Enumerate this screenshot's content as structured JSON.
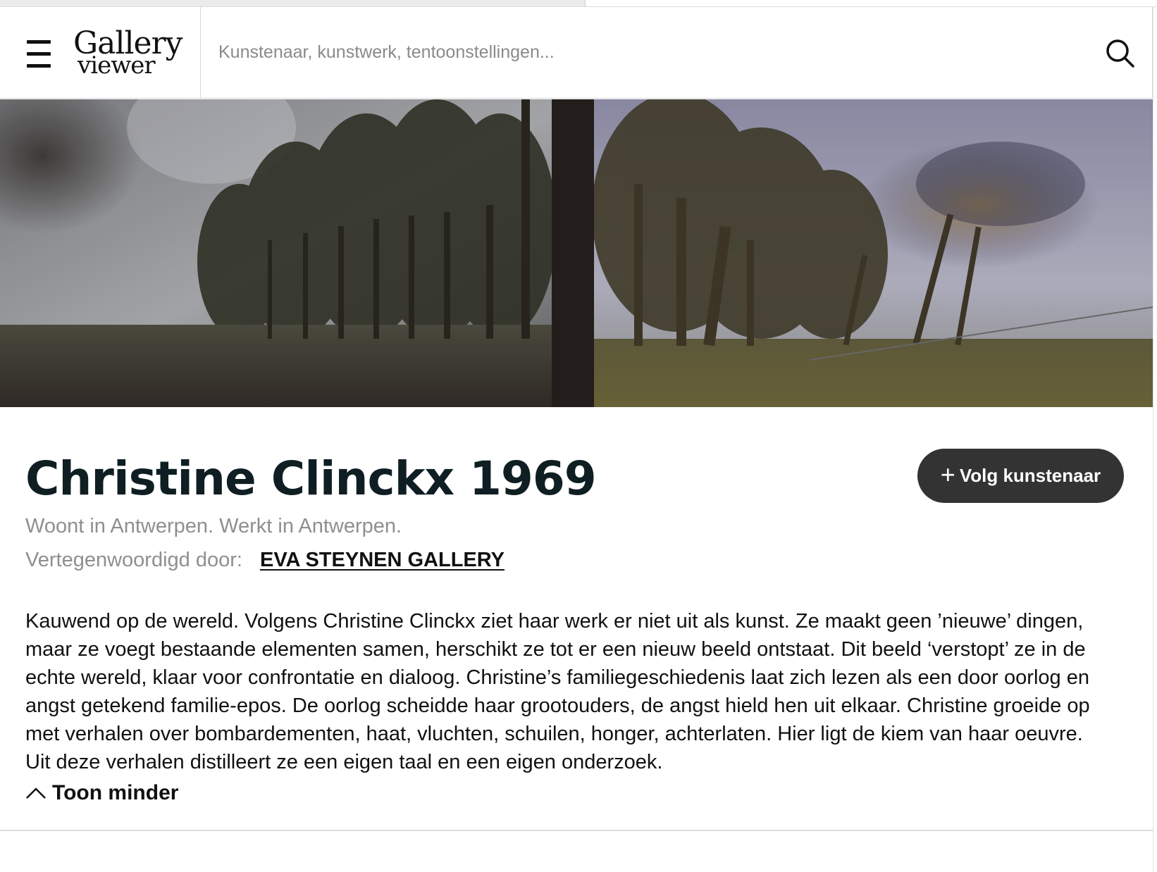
{
  "header": {
    "logo_line1": "Gallery",
    "logo_line2": "viewer",
    "search_placeholder": "Kunstenaar, kunstwerk, tentoonstellingen..."
  },
  "artist": {
    "name": "Christine Clinckx 1969",
    "follow_plus": "+",
    "follow_label": "Volg kunstenaar",
    "location": "Woont in Antwerpen. Werkt in Antwerpen.",
    "represented_label": "Vertegenwoordigd door:",
    "gallery_name": "EVA STEYNEN GALLERY",
    "bio_lines": [
      "Kauwend op de wereld. Volgens Christine Clinckx ziet haar werk er niet uit als kunst. Ze maakt geen ’nieuwe’ dingen,",
      "maar ze voegt bestaande elementen samen, herschikt ze tot er een nieuw beeld ontstaat. Dit beeld ‘verstopt’ ze in de",
      "echte wereld, klaar voor confrontatie en dialoog. Christine’s familiegeschiedenis laat zich lezen als een door oorlog en",
      "angst getekend familie-epos. De oorlog scheidde haar grootouders, de angst hield hen uit elkaar. Christine groeide op",
      "met verhalen over bombardementen, haat, vluchten, schuilen, honger, achterlaten. Hier ligt de kiem van haar oeuvre.",
      "Uit deze verhalen distilleert ze een eigen taal en een eigen onderzoek."
    ],
    "toggle_label": "Toon minder"
  },
  "icons": {
    "menu": "hamburger-menu-icon",
    "search": "search-icon",
    "toggle": "chevron-up-icon"
  },
  "colors": {
    "text": "#0f1e22",
    "muted": "#8f8f8f",
    "button_bg": "#333333",
    "button_text": "#ffffff"
  }
}
